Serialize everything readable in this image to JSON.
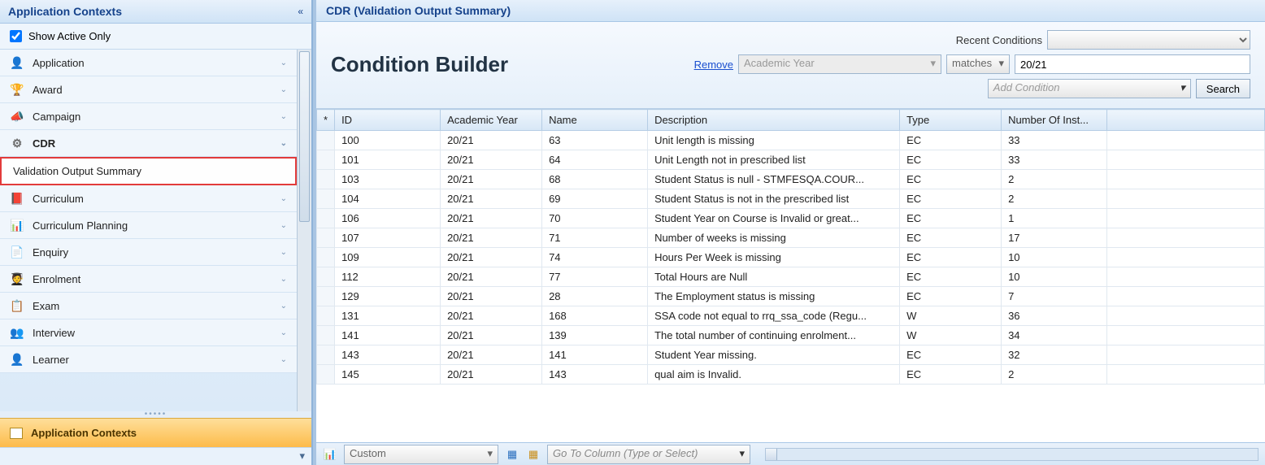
{
  "sidebar": {
    "title": "Application Contexts",
    "show_active_label": "Show Active Only",
    "show_active_checked": true,
    "items": [
      {
        "label": "Application",
        "icon": "👤",
        "icon_class": "ico-red"
      },
      {
        "label": "Award",
        "icon": "🏆",
        "icon_class": "ico-gold"
      },
      {
        "label": "Campaign",
        "icon": "📣",
        "icon_class": "ico-gold"
      },
      {
        "label": "CDR",
        "icon": "⚙",
        "icon_class": "ico-gray",
        "bold": true
      },
      {
        "label": "Curriculum",
        "icon": "📕",
        "icon_class": "ico-red"
      },
      {
        "label": "Curriculum Planning",
        "icon": "📊",
        "icon_class": "ico-blue"
      },
      {
        "label": "Enquiry",
        "icon": "📄",
        "icon_class": "ico-blue"
      },
      {
        "label": "Enrolment",
        "icon": "🧑‍🎓",
        "icon_class": "ico-blue"
      },
      {
        "label": "Exam",
        "icon": "📋",
        "icon_class": "ico-gold"
      },
      {
        "label": "Interview",
        "icon": "👥",
        "icon_class": "ico-blue"
      },
      {
        "label": "Learner",
        "icon": "👤",
        "icon_class": "ico-red"
      }
    ],
    "sub_item": "Validation Output Summary",
    "footer": "Application Contexts"
  },
  "main": {
    "title": "CDR (Validation Output Summary)",
    "builder_title": "Condition Builder",
    "recent_label": "Recent Conditions",
    "remove_label": "Remove",
    "field_value": "Academic Year",
    "operator_value": "matches",
    "value_text": "20/21",
    "add_condition_placeholder": "Add Condition",
    "search_label": "Search"
  },
  "table": {
    "columns": [
      "*",
      "ID",
      "Academic Year",
      "Name",
      "Description",
      "Type",
      "Number Of Inst..."
    ],
    "rows": [
      {
        "id": "100",
        "ay": "20/21",
        "name": "63",
        "desc": "Unit length is missing",
        "type": "EC",
        "num": "33"
      },
      {
        "id": "101",
        "ay": "20/21",
        "name": "64",
        "desc": "Unit Length not in prescribed list",
        "type": "EC",
        "num": "33"
      },
      {
        "id": "103",
        "ay": "20/21",
        "name": "68",
        "desc": "Student Status is  null - STMFESQA.COUR...",
        "type": "EC",
        "num": "2"
      },
      {
        "id": "104",
        "ay": "20/21",
        "name": "69",
        "desc": "Student Status is not in the prescribed list",
        "type": "EC",
        "num": "2"
      },
      {
        "id": "106",
        "ay": "20/21",
        "name": "70",
        "desc": "Student Year on Course is Invalid or great...",
        "type": "EC",
        "num": "1"
      },
      {
        "id": "107",
        "ay": "20/21",
        "name": "71",
        "desc": "Number of weeks is missing",
        "type": "EC",
        "num": "17"
      },
      {
        "id": "109",
        "ay": "20/21",
        "name": "74",
        "desc": "Hours Per Week is missing",
        "type": "EC",
        "num": "10"
      },
      {
        "id": "112",
        "ay": "20/21",
        "name": "77",
        "desc": "Total Hours are Null",
        "type": "EC",
        "num": "10"
      },
      {
        "id": "129",
        "ay": "20/21",
        "name": "28",
        "desc": "The Employment status is missing",
        "type": "EC",
        "num": "7"
      },
      {
        "id": "131",
        "ay": "20/21",
        "name": "168",
        "desc": "SSA code not equal to rrq_ssa_code (Regu...",
        "type": "W",
        "num": "36"
      },
      {
        "id": "141",
        "ay": "20/21",
        "name": "139",
        "desc": "The total number of continuing enrolment...",
        "type": "W",
        "num": "34"
      },
      {
        "id": "143",
        "ay": "20/21",
        "name": "141",
        "desc": "Student Year missing.",
        "type": "EC",
        "num": "32"
      },
      {
        "id": "145",
        "ay": "20/21",
        "name": "143",
        "desc": "qual aim is Invalid.",
        "type": "EC",
        "num": "2"
      }
    ]
  },
  "bottombar": {
    "mode": "Custom",
    "goto_placeholder": "Go To Column (Type or Select)"
  }
}
